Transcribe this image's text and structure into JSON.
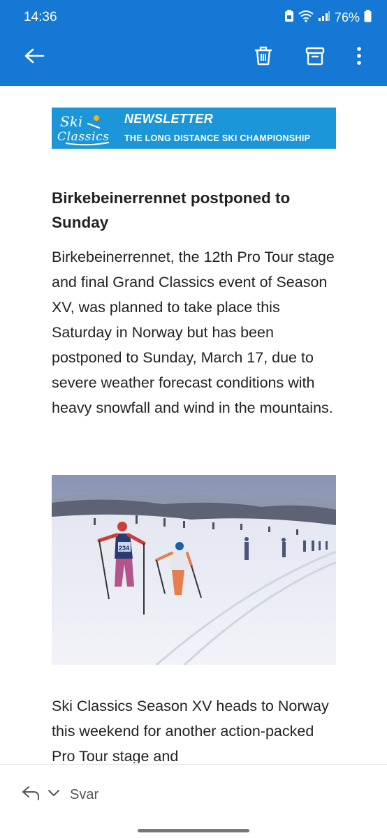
{
  "status_bar": {
    "time": "14:36",
    "battery": "76%"
  },
  "app_bar": {
    "back_icon": "arrow-left-icon",
    "actions": [
      "trash-icon",
      "archive-icon",
      "more-vertical-icon"
    ]
  },
  "newsletter": {
    "banner": {
      "logo_line1": "Ski",
      "logo_line2": "Classics",
      "title": "NEWSLETTER",
      "subtitle": "THE LONG DISTANCE SKI CHAMPIONSHIP"
    },
    "headline": "Birkebeinerrennet postponed to Sunday",
    "paragraph1": "Birkebeinerrennet, the 12th Pro Tour stage and final Grand Classics event of Season XV, was planned to take place this Saturday in Norway but has been postponed to Sunday, March 17, due to severe weather forecast conditions with heavy snowfall and wind in the mountains.",
    "photo": {
      "bib_number": "234"
    },
    "paragraph2": "Ski Classics Season XV heads to Norway this weekend for another action-packed Pro Tour stage and"
  },
  "reply_bar": {
    "label": "Svar"
  },
  "colors": {
    "app_blue": "#1478d4",
    "banner_blue": "#1b96d8"
  }
}
